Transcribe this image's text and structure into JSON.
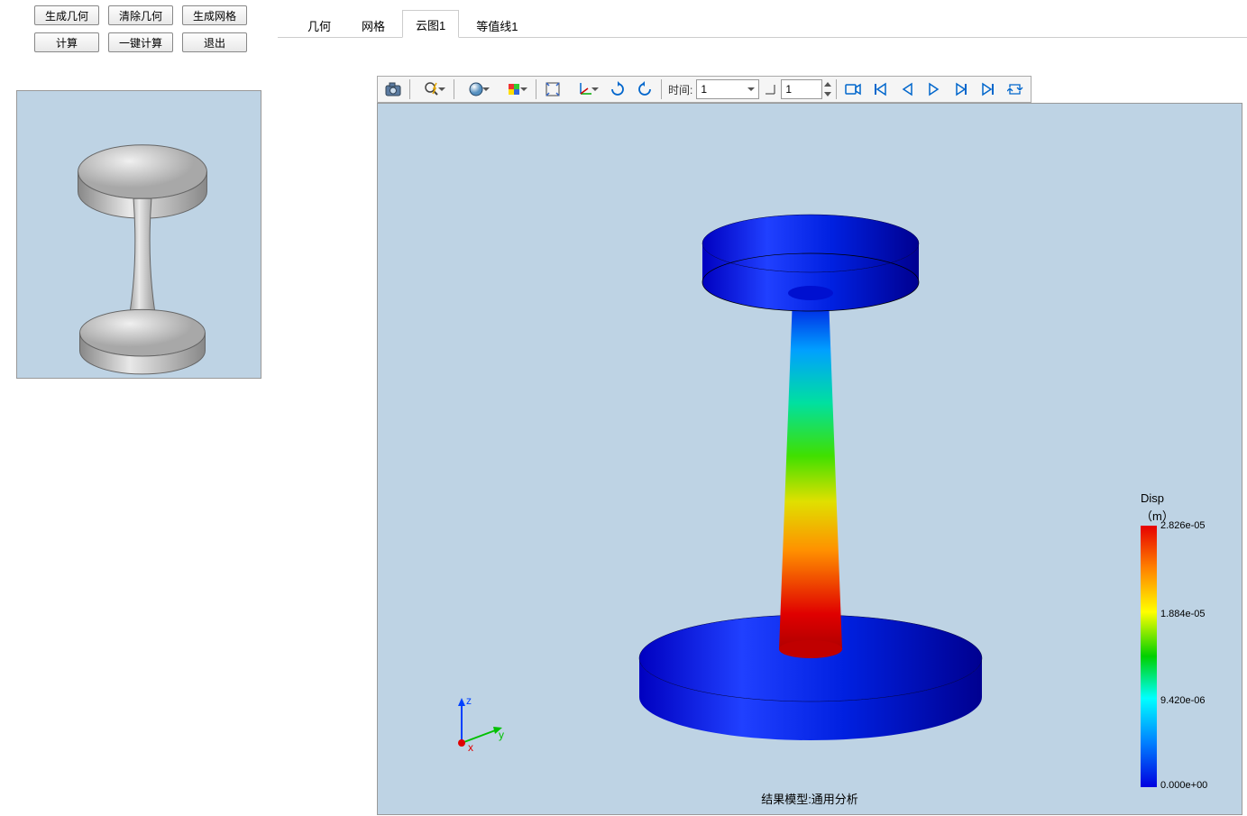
{
  "buttons": {
    "gen_geom": "生成几何",
    "clear_geom": "清除几何",
    "gen_mesh": "生成网格",
    "compute": "计算",
    "one_click": "一键计算",
    "exit": "退出"
  },
  "tabs": {
    "t0": "几何",
    "t1": "网格",
    "t2": "云图1",
    "t3": "等值线1"
  },
  "toolbar": {
    "time_label": "时间:",
    "time_value": "1",
    "frame_value": "1"
  },
  "legend": {
    "title": "Disp",
    "unit": "（m）",
    "max": "2.826e-05",
    "mid": "1.884e-05",
    "q": "9.420e-06",
    "min": "0.000e+00"
  },
  "axes": {
    "z": "z",
    "y": "y",
    "x": "x"
  },
  "result_label": "结果模型:通用分析"
}
